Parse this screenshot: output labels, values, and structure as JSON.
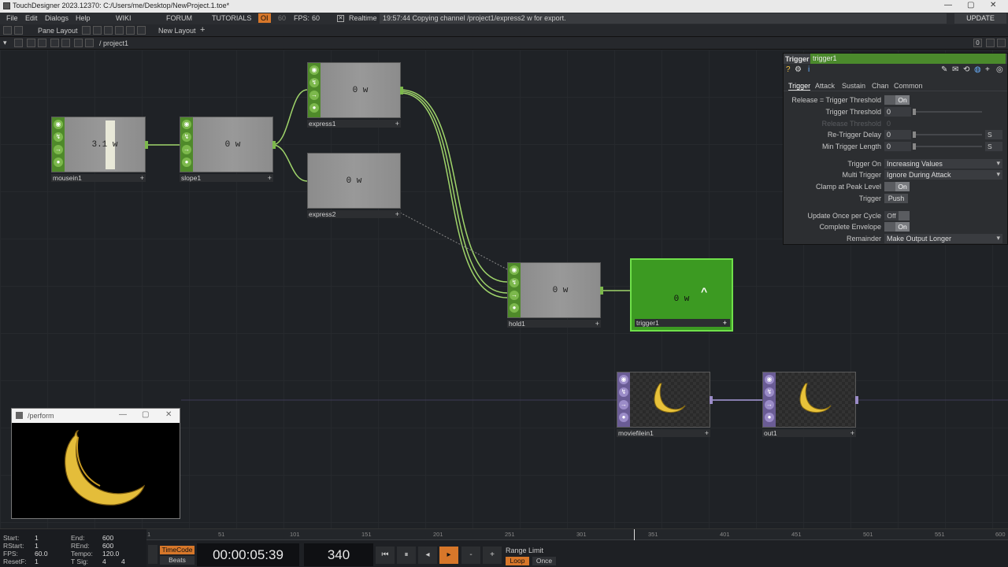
{
  "app": {
    "title": "TouchDesigner 2023.12370: C:/Users/me/Desktop/NewProject.1.toe*",
    "window_buttons": [
      "—",
      "▢",
      "✕"
    ]
  },
  "menu": {
    "items": [
      "File",
      "Edit",
      "Dialogs",
      "Help"
    ],
    "links": [
      "WIKI",
      "FORUM",
      "TUTORIALS"
    ],
    "oi_label": "OI",
    "fps_limit": "60",
    "fps_label": "FPS:",
    "fps_value": "60",
    "realtime_label": "Realtime",
    "status_message": "19:57:44 Copying channel /project1/express2 w for export.",
    "update_label": "UPDATE"
  },
  "panebar": {
    "pane_layout": "Pane Layout",
    "new_layout": "New Layout",
    "add": "+"
  },
  "pathbar": {
    "path": "/ project1",
    "right_value": "0"
  },
  "nodes": {
    "mousein1": {
      "label": "mousein1",
      "value": "3.1 w"
    },
    "slope1": {
      "label": "slope1",
      "value": "0 w"
    },
    "express1": {
      "label": "express1",
      "value": "0 w"
    },
    "express2": {
      "label": "express2",
      "value": "0 w"
    },
    "hold1": {
      "label": "hold1",
      "value": "0 w"
    },
    "trigger1": {
      "label": "trigger1",
      "value": "0 w",
      "marker": "^"
    },
    "moviefilein1": {
      "label": "moviefilein1"
    },
    "out1": {
      "label": "out1"
    }
  },
  "params": {
    "op_type": "Trigger",
    "op_name": "trigger1",
    "tabs": [
      "Trigger",
      "Attack",
      "Sustain",
      "Chan",
      "Common"
    ],
    "rows": {
      "release": {
        "label": "Release = Trigger Threshold",
        "value": "On"
      },
      "threshold": {
        "label": "Trigger Threshold",
        "value": "0"
      },
      "release_threshold": {
        "label": "Release Threshold",
        "value": "0"
      },
      "retrigger": {
        "label": "Re-Trigger Delay",
        "value": "0",
        "unit": "S"
      },
      "min_length": {
        "label": "Min Trigger Length",
        "value": "0",
        "unit": "S"
      },
      "trigger_on": {
        "label": "Trigger On",
        "value": "Increasing Values"
      },
      "multi": {
        "label": "Multi Trigger",
        "value": "Ignore During Attack"
      },
      "clamp": {
        "label": "Clamp at Peak Level",
        "value": "On"
      },
      "trigger": {
        "label": "Trigger",
        "value": "Push"
      },
      "update_once": {
        "label": "Update Once per Cycle",
        "value": "Off"
      },
      "complete": {
        "label": "Complete Envelope",
        "value": "On"
      },
      "remainder": {
        "label": "Remainder",
        "value": "Make Output Longer"
      }
    }
  },
  "perform": {
    "title": "/perform"
  },
  "timeline": {
    "info": {
      "start_k": "Start:",
      "start_v": "1",
      "end_k": "End:",
      "end_v": "600",
      "rstart_k": "RStart:",
      "rstart_v": "1",
      "rend_k": "REnd:",
      "rend_v": "600",
      "fps_k": "FPS:",
      "fps_v": "60.0",
      "tempo_k": "Tempo:",
      "tempo_v": "120.0",
      "resetf_k": "ResetF:",
      "resetf_v": "1",
      "tsig_k": "T Sig:",
      "tsig_v1": "4",
      "tsig_v2": "4"
    },
    "ruler_ticks": [
      "1",
      "51",
      "101",
      "151",
      "201",
      "251",
      "301",
      "351",
      "401",
      "451",
      "501",
      "551",
      "600"
    ],
    "timecode_btn": "TimeCode",
    "beats_btn": "Beats",
    "timecode": "00:00:05:39",
    "frame": "340",
    "range_limit": "Range Limit",
    "loop": "Loop",
    "once": "Once"
  },
  "colors": {
    "chop_green": "#4f8a2a",
    "top_purple": "#6a5c95",
    "accent_orange": "#d7772a",
    "trigger_active": "#3c9a22"
  }
}
